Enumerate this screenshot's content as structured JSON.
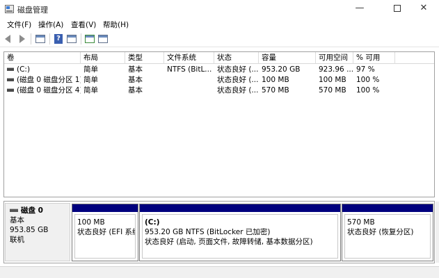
{
  "window": {
    "title": "磁盘管理",
    "minimize": "—",
    "close": "✕"
  },
  "menu": [
    "文件(F)",
    "操作(A)",
    "查看(V)",
    "帮助(H)"
  ],
  "toolbar": {
    "icons": [
      "back-icon",
      "forward-icon",
      "console-tree-icon",
      "help-icon",
      "properties-icon",
      "connect-icon",
      "detail-icon"
    ]
  },
  "volume_list": {
    "columns": [
      "卷",
      "布局",
      "类型",
      "文件系统",
      "状态",
      "容量",
      "可用空间",
      "% 可用"
    ],
    "rows": [
      [
        "(C:)",
        "简单",
        "基本",
        "NTFS (BitL...",
        "状态良好 (...",
        "953.20 GB",
        "923.96 ...",
        "97 %"
      ],
      [
        "(磁盘 0 磁盘分区 1)",
        "简单",
        "基本",
        "",
        "状态良好 (...",
        "100 MB",
        "100 MB",
        "100 %"
      ],
      [
        "(磁盘 0 磁盘分区 4)",
        "简单",
        "基本",
        "",
        "状态良好 (...",
        "570 MB",
        "570 MB",
        "100 %"
      ]
    ]
  },
  "disk": {
    "name": "磁盘 0",
    "type": "基本",
    "size": "953.85 GB",
    "status": "联机",
    "partitions": [
      {
        "name": "",
        "size": "100 MB",
        "status": "状态良好 (EFI 系统分区)"
      },
      {
        "name": "(C:)",
        "size": "953.20 GB NTFS (BitLocker 已加密)",
        "status": "状态良好 (启动, 页面文件, 故障转储, 基本数据分区)"
      },
      {
        "name": "",
        "size": "570 MB",
        "status": "状态良好 (恢复分区)"
      }
    ]
  },
  "colors": {
    "partition_header": "#00007e",
    "disk_label_bg": "#f0f0f0"
  }
}
